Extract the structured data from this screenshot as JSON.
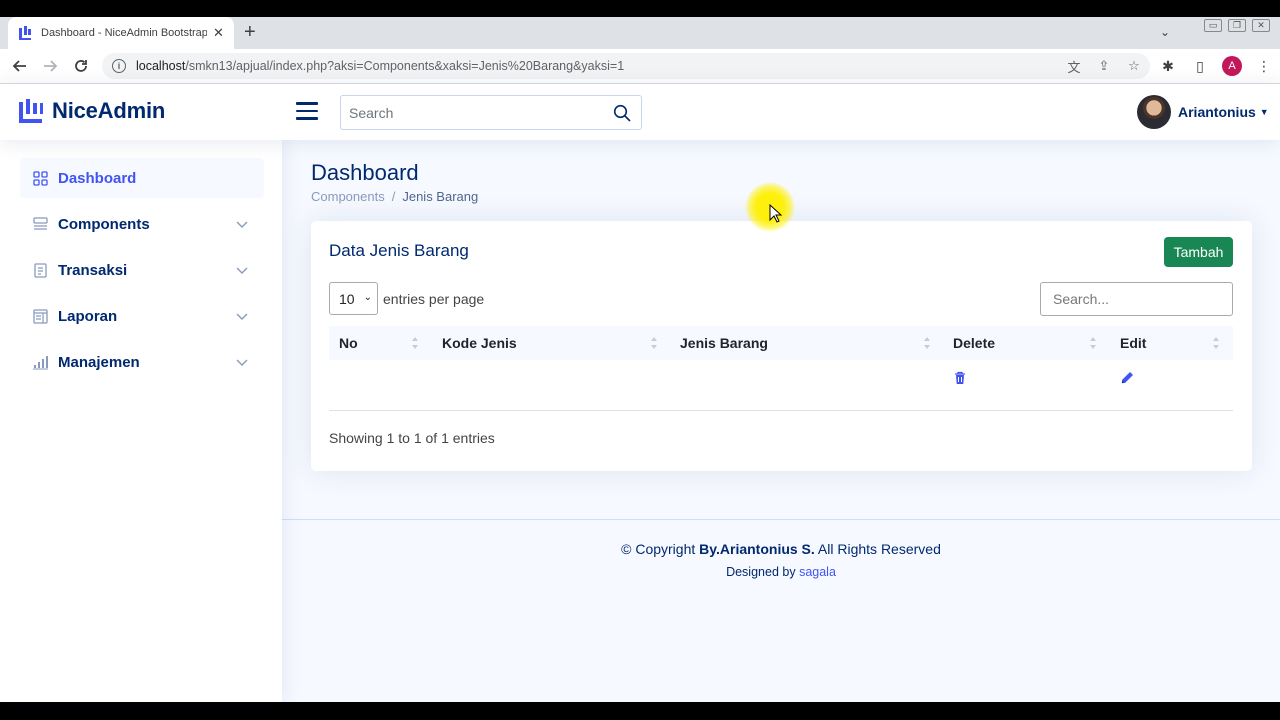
{
  "browser": {
    "tab_title": "Dashboard - NiceAdmin Bootstrap Template",
    "new_tab_label": "+",
    "url_host": "localhost",
    "url_path": "/smkn13/apjual/index.php?aksi=Components&xaksi=Jenis%20Barang&yaksi=1",
    "profile_initial": "A"
  },
  "header": {
    "logo_text": "NiceAdmin",
    "search_placeholder": "Search",
    "user_name": "Ariantonius"
  },
  "sidebar": {
    "items": [
      {
        "label": "Dashboard",
        "icon": "grid-icon",
        "active": true
      },
      {
        "label": "Components",
        "icon": "menu-button-icon",
        "expandable": true
      },
      {
        "label": "Transaksi",
        "icon": "journal-text-icon",
        "expandable": true
      },
      {
        "label": "Laporan",
        "icon": "layout-text-window-icon",
        "expandable": true
      },
      {
        "label": "Manajemen",
        "icon": "bar-chart-icon",
        "expandable": true
      }
    ]
  },
  "main": {
    "page_title": "Dashboard",
    "breadcrumb": {
      "parent": "Components",
      "separator": "/",
      "current": "Jenis Barang"
    },
    "card": {
      "title": "Data Jenis Barang",
      "add_button": "Tambah",
      "per_page_value": "10",
      "per_page_label": "entries per page",
      "search_placeholder": "Search...",
      "columns": [
        "No",
        "Kode Jenis",
        "Jenis Barang",
        "Delete",
        "Edit"
      ],
      "rows": [
        {
          "no": "",
          "kode_jenis": "",
          "jenis_barang": "",
          "delete_icon": "trash-icon",
          "edit_icon": "pencil-icon"
        }
      ],
      "info": "Showing 1 to 1 of 1 entries"
    }
  },
  "footer": {
    "copyright_prefix": "© Copyright",
    "copyright_owner": "By.Ariantonius S.",
    "copyright_suffix": "All Rights Reserved",
    "designed_by": "Designed by",
    "designer": "sagala"
  },
  "colors": {
    "brand": "#012970",
    "accent": "#4154f1",
    "success": "#198754",
    "background": "#f6f9ff"
  }
}
